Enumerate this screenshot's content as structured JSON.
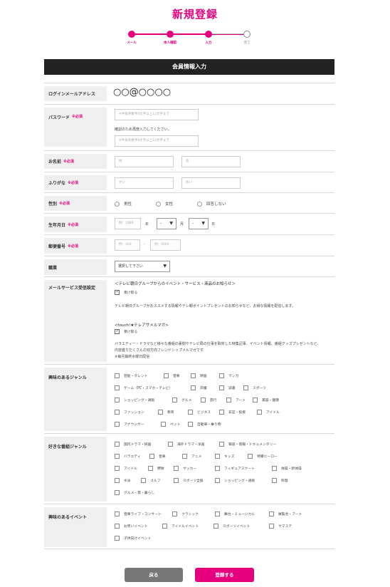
{
  "title": "新規登録",
  "steps": [
    "メール",
    "本人確認",
    "入力",
    "完了"
  ],
  "section_header": "会員情報入力",
  "login_email": {
    "label": "ログインメールアドレス",
    "value": "○○@○○○○"
  },
  "password": {
    "label": "パスワード",
    "required": "※必須",
    "placeholder": "※半角英数字8文字以上12文字まで",
    "confirm_note": "確認のため再度入力してください。",
    "confirm_placeholder": "※半角英数字8文字以上12文字まで"
  },
  "name": {
    "label": "お名前",
    "required": "※必須",
    "last": "姓",
    "first": "名"
  },
  "furigana": {
    "label": "ふりがな",
    "required": "※必須",
    "last": "せい",
    "first": "めい"
  },
  "gender": {
    "label": "性別",
    "required": "※必須",
    "options": [
      "男性",
      "女性",
      "回答しない"
    ]
  },
  "birthday": {
    "label": "生年月日",
    "required": "※必須",
    "year_placeholder": "例：1980",
    "year_unit": "年",
    "month_value": "–",
    "month_unit": "月",
    "day_value": "–",
    "day_unit": "日"
  },
  "postal": {
    "label": "郵便番号",
    "required": "※必須",
    "first_placeholder": "例：300",
    "separator": "-",
    "second_placeholder": "例：0000"
  },
  "job": {
    "label": "職業",
    "value": "選択して下さい"
  },
  "mail_service": {
    "label": "メールサービス受信設定",
    "group1_title": "＜テレビ朝日グループからのイベント・サービス・商品のお知らせ＞",
    "group1_check": "受け取る",
    "group1_desc": "テレビ朝日グループがおススメする情報やテレ朝ポイントプレゼントのお知らせなど、お得な情報を配信します。",
    "group2_title": "<touch!★テレアサメルマガ>",
    "group2_check": "受け取る",
    "group2_desc1": "バラエティー・ドラマなど様々な番組の裏側やテレビ局の仕事を取材した特集記事、イベント情報、番組グッズプレゼントなど、内容盛りだくさんの双方向フレンドシップメルマガです",
    "group2_desc2": "※毎月最終水曜日配信"
  },
  "genres": {
    "label": "興味のあるジャンル",
    "items": [
      "芸能・タレント",
      "音楽",
      "映画",
      "マンガ",
      "ゲーム（PC・スマホ・テレビ）",
      "声優",
      "読書",
      "スポーツ",
      "ショッピング・通販",
      "グルメ",
      "旅行",
      "アート",
      "美容・健康",
      "ファッション",
      "教育",
      "ビジネス",
      "非営・投資",
      "アイドル",
      "アナウンサー",
      "ペット",
      "自動車・乗り物"
    ]
  },
  "programs": {
    "label": "好きな番組ジャンル",
    "items": [
      "国内ドラマ・純画",
      "海外ドラマ・洋画",
      "報道・情報・ドキュメンタリー",
      "バラエティ",
      "音楽",
      "アニメ",
      "キッズ",
      "特撮ヒーロー",
      "アイドル",
      "野球",
      "サッカー",
      "フィギュアスケート",
      "体操・新体操",
      "水泳",
      "ゴルフ",
      "スポーツ全般",
      "ショッピング・通販",
      "料理",
      "グルメ・旅・暮らし"
    ]
  },
  "events": {
    "label": "興味のあるイベント",
    "items": [
      "音楽ライブ・コンサート",
      "クラシック",
      "舞台・ミュージカル",
      "展覧会・アート",
      "お笑いイベント",
      "アイドルイベント",
      "スポーツイベント",
      "サマステ",
      "子供向けイベント"
    ]
  },
  "buttons": {
    "back": "戻る",
    "register": "登録する"
  }
}
